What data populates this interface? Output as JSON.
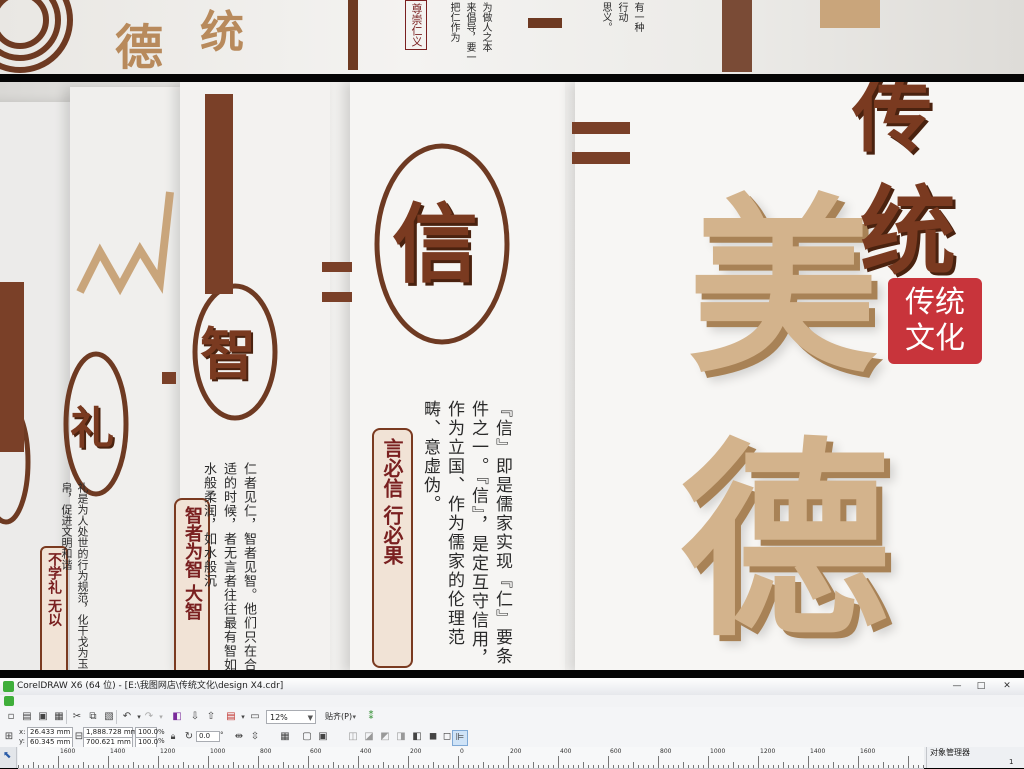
{
  "preview": {
    "strip_chars": {
      "c1": "德",
      "c2": "统",
      "seal": "尊崇仁义",
      "frag1": "为做人之本",
      "frag2": "来倡导，要一",
      "frag3": "把仁作为",
      "frag4": "思义。",
      "frag5": "有一种",
      "frag6": "行动"
    },
    "circle_chars": {
      "xin": "信",
      "zhi": "智",
      "li": "礼"
    },
    "title_chars": {
      "mei": "美",
      "de": "德",
      "chuan": "传",
      "tong": "统"
    },
    "red_seal": "传统文化",
    "xin_motto": "言必信  行必果",
    "zhi_motto": "智者为智  大智",
    "li_motto": "不学礼  无以",
    "xin_paragraph": "『信』即是儒家实现『仁』要条件之一。『信』，是定互守信用，作为立国、作为儒家的伦理范畴、意虚伪。",
    "zhi_paragraph": "仁者见仁，智者见智。他们只在合适的时候，者无言者往往最有智如水般柔润，如水般沉",
    "li_paragraph": "礼是为人处世的行为规范，化干戈为玉帛，促进文明和谐"
  },
  "window": {
    "title": "CorelDRAW X6 (64 位) - [E:\\我图网店\\传统文化\\design X4.cdr]",
    "minimize": "—",
    "maximize": "□",
    "close": "✕"
  },
  "toolbar": {
    "zoom": "12%",
    "snap": "贴齐(P)"
  },
  "propbar": {
    "x_label": "x:",
    "y_label": "y:",
    "x": "26.433 mm",
    "y": "60.345 mm",
    "w": "1,888.728 mm",
    "h": "700.621 mm",
    "sx": "100.0",
    "sy": "100.0",
    "pct": "%",
    "angle": "0.0",
    "deg": "°"
  },
  "ruler": {
    "ticks": [
      "1600",
      "1400",
      "1200",
      "1000",
      "800",
      "600",
      "400",
      "200",
      "0",
      "200",
      "400",
      "600",
      "800",
      "1000",
      "1200",
      "1400",
      "1600"
    ]
  },
  "docker": {
    "title": "对象管理器",
    "page": "1"
  }
}
